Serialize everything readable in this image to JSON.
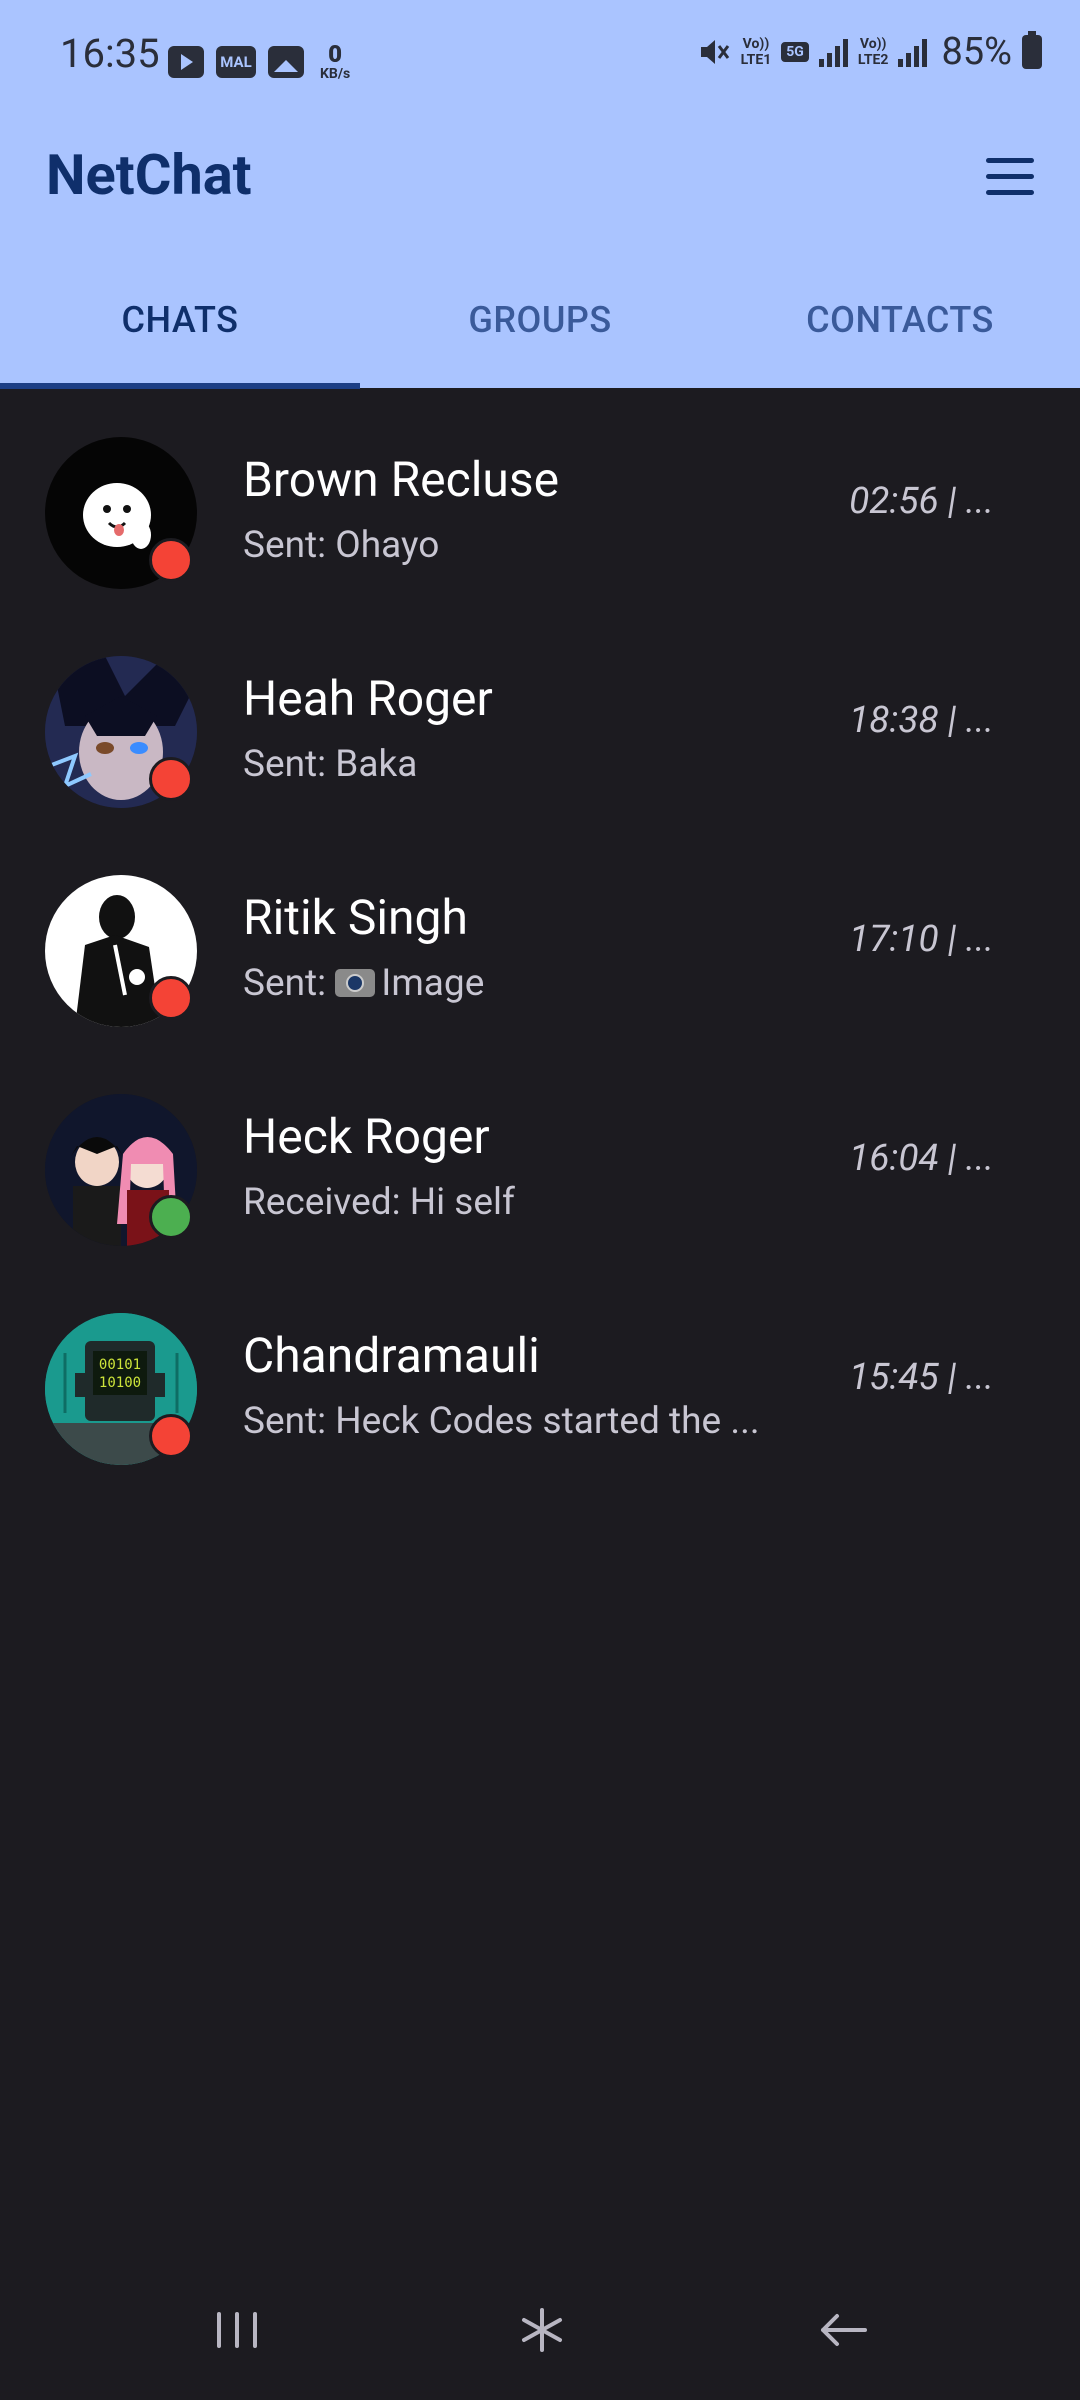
{
  "status_bar": {
    "time": "16:35",
    "network_speed_value": "0",
    "network_speed_unit": "KB/s",
    "mal_label": "MAL",
    "sim1_label": "LTE1",
    "sim2_label": "LTE2",
    "volte_label": "Vo))",
    "network_type": "5G",
    "battery": "85%"
  },
  "app": {
    "title": "NetChat"
  },
  "tabs": [
    {
      "label": "CHATS",
      "active": true
    },
    {
      "label": "GROUPS",
      "active": false
    },
    {
      "label": "CONTACTS",
      "active": false
    }
  ],
  "chats": [
    {
      "name": "Brown Recluse",
      "preview": "Sent: Ohayo",
      "time": "02:56 | ...",
      "status": "offline",
      "status_color": "#f44336"
    },
    {
      "name": "Heah Roger",
      "preview": "Sent: Baka",
      "time": "18:38 | ...",
      "status": "offline",
      "status_color": "#f44336"
    },
    {
      "name": "Ritik Singh",
      "preview_prefix": "Sent:",
      "preview_text": "Image",
      "preview_icon": "camera-icon",
      "time": "17:10 | ...",
      "status": "offline",
      "status_color": "#f44336"
    },
    {
      "name": "Heck Roger",
      "preview": "Received: Hi self",
      "time": "16:04 | ...",
      "status": "online",
      "status_color": "#4caf50"
    },
    {
      "name": "Chandramauli",
      "preview": "Sent: Heck Codes started the ...",
      "time": "15:45 | ...",
      "status": "offline",
      "status_color": "#f44336",
      "avatar_text_1": "00101",
      "avatar_text_2": "10100"
    }
  ],
  "colors": {
    "header_bg": "#aac4ff",
    "title": "#0f2f6b",
    "body_bg": "#1c1b20",
    "online": "#4caf50",
    "offline": "#f44336"
  }
}
